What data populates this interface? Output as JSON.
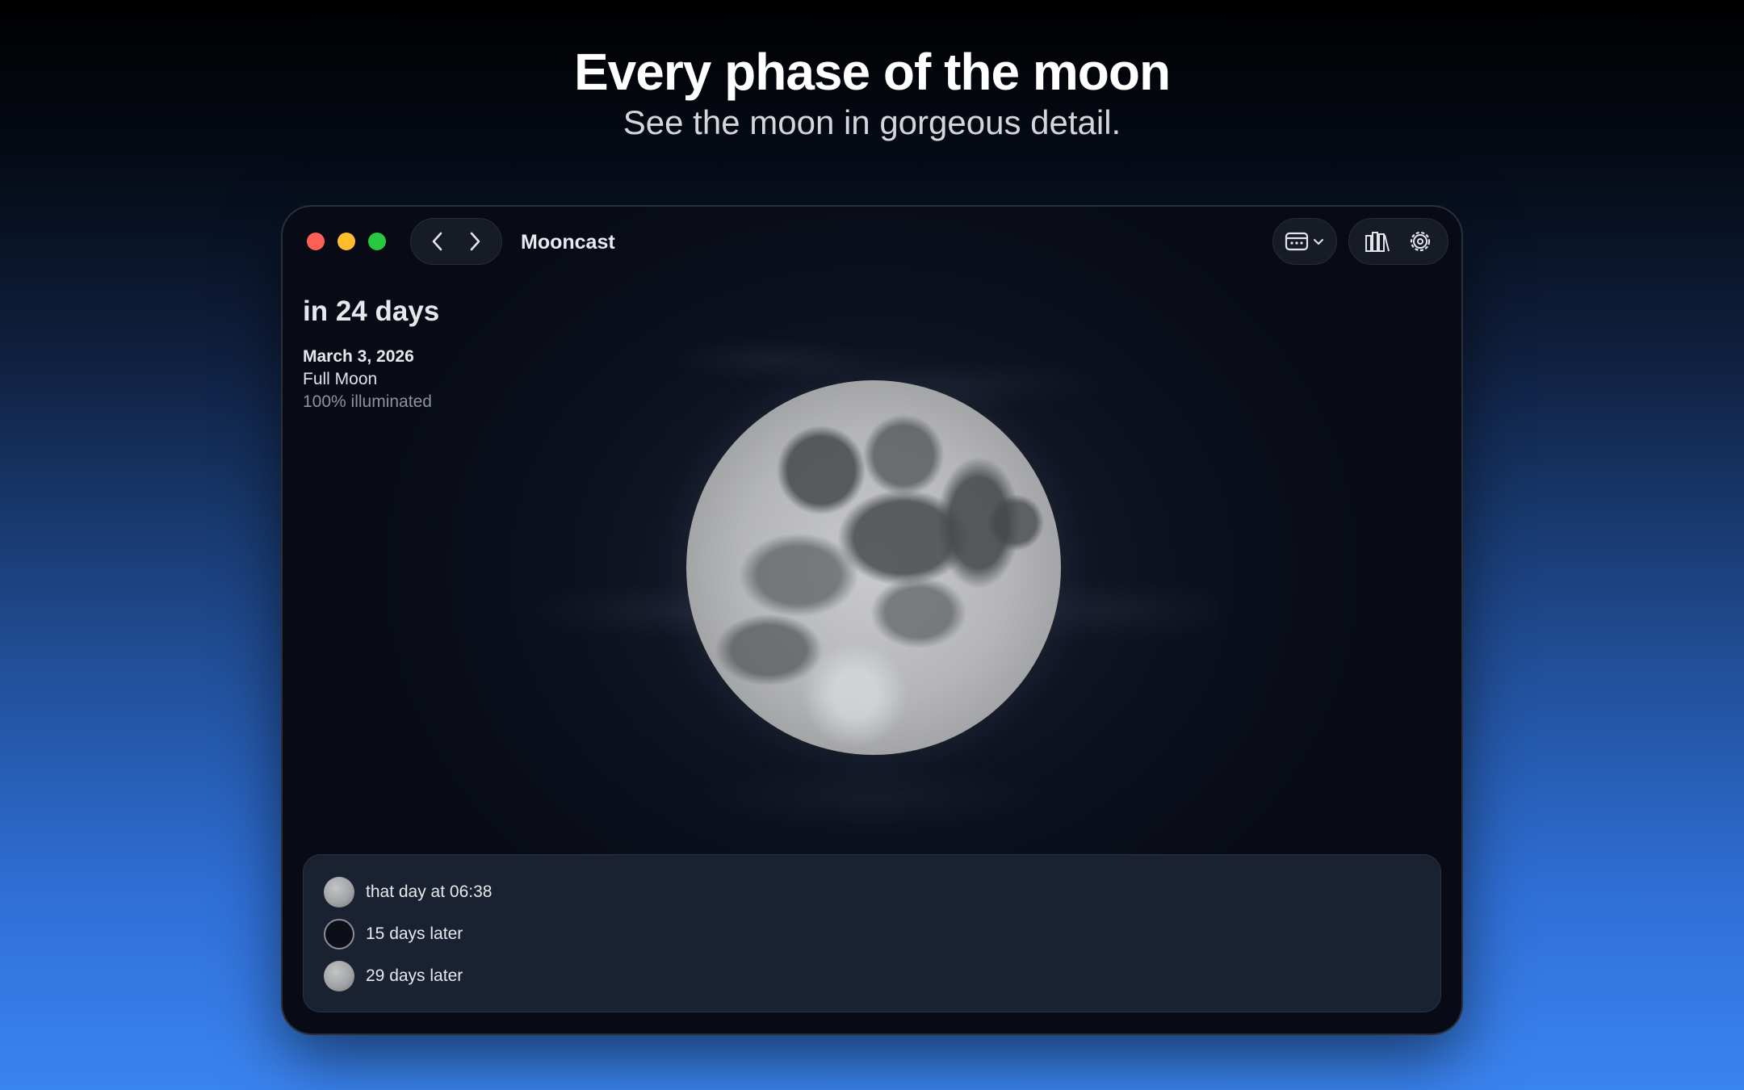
{
  "marketing": {
    "headline": "Every phase of the moon",
    "subheadline": "See the moon in gorgeous detail."
  },
  "window": {
    "title": "Mooncast"
  },
  "info": {
    "countdown": "in 24 days",
    "date": "March 3, 2026",
    "phase": "Full Moon",
    "illumination": "100% illuminated"
  },
  "upcoming": [
    {
      "label": "that day at 06:38",
      "icon": "full-moon-icon"
    },
    {
      "label": "15 days later",
      "icon": "new-moon-icon"
    },
    {
      "label": "29 days later",
      "icon": "full-moon-icon"
    }
  ],
  "icons": {
    "back": "chevron-left-icon",
    "forward": "chevron-right-icon",
    "calendar": "calendar-icon",
    "dropdown": "chevron-down-icon",
    "library": "library-icon",
    "settings": "gear-icon"
  },
  "colors": {
    "close": "#fe5f57",
    "minimize": "#febc2e",
    "zoom": "#28c840"
  }
}
